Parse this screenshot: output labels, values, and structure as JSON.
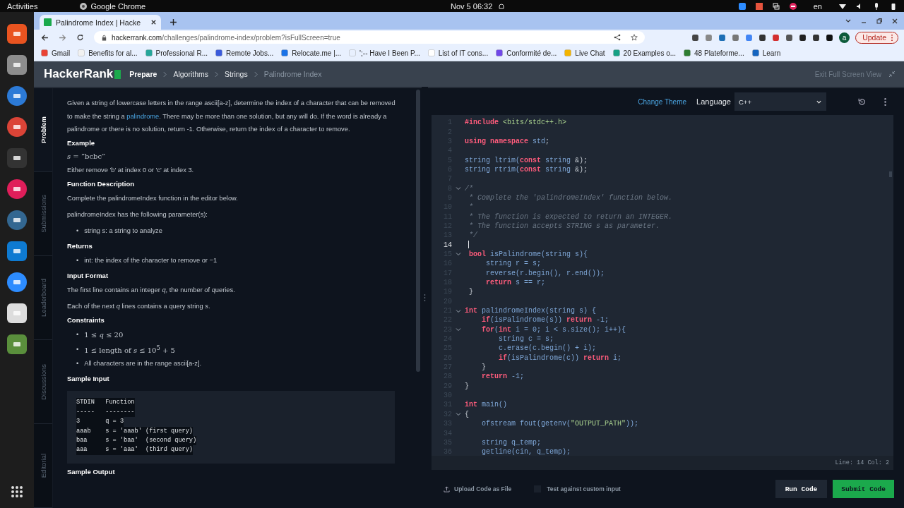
{
  "topbar": {
    "activities": "Activities",
    "app": "Google Chrome",
    "clock": "Nov 5  06:32",
    "lang": "en"
  },
  "browser": {
    "tab_title": "Palindrome Index | Hacke",
    "url_domain": "hackerrank.com",
    "url_path": "/challenges/palindrome-index/problem?isFullScreen=true",
    "profile": "a",
    "update": "Update",
    "bookmarks": [
      "Gmail",
      "Benefits for al...",
      "Professional R...",
      "Remote Jobs...",
      "Relocate.me |...",
      "';-- Have I Been P...",
      "List of IT cons...",
      "Conformité de...",
      "Live Chat",
      "20 Examples o...",
      "48 Plateforme...",
      "Learn"
    ]
  },
  "site": {
    "logo": "HackerRank",
    "breadcrumbs": [
      {
        "label": "Prepare",
        "current": false
      },
      {
        "label": "Algorithms",
        "current": false
      },
      {
        "label": "Strings",
        "current": false
      },
      {
        "label": "Palindrome Index",
        "current": true
      }
    ],
    "exit": "Exit Full Screen View"
  },
  "side_tabs": [
    {
      "label": "Problem",
      "selected": true
    },
    {
      "label": "Submissions",
      "selected": false
    },
    {
      "label": "Leaderboard",
      "selected": false
    },
    {
      "label": "Discussions",
      "selected": false
    },
    {
      "label": "Editorial",
      "selected": false
    }
  ],
  "problem": [
    {
      "kind": "intro",
      "before": "Given a string of lowercase letters in the range ascii[a-z], determine the index of a character that can be removed to make the string a ",
      "link": "palindrome",
      "after": ". There may be more than one solution, but any will do. If the word is already a palindrome or there is no solution, return -1. Otherwise, return the index of a character to remove."
    },
    {
      "kind": "heading",
      "text": "Example"
    },
    {
      "kind": "math",
      "text": "*s* = ”bcbc”"
    },
    {
      "kind": "para",
      "text": "Either remove 'b' at index 0 or 'c' at index 3."
    },
    {
      "kind": "heading",
      "text": "Function Description"
    },
    {
      "kind": "para",
      "text": "Complete the palindromeIndex function in the editor below."
    },
    {
      "kind": "para",
      "text": "palindromeIndex has the following parameter(s):"
    },
    {
      "kind": "bullets",
      "items": [
        {
          "marker": "•",
          "text": "string s: a string to analyze",
          "math": false
        }
      ]
    },
    {
      "kind": "heading",
      "text": "Returns"
    },
    {
      "kind": "bullets",
      "items": [
        {
          "marker": "•",
          "text": "int: the index of the character to remove or −1",
          "math": false
        }
      ]
    },
    {
      "kind": "heading",
      "text": "Input Format"
    },
    {
      "kind": "para",
      "text": "The first line contains an integer *q*, the number of queries."
    },
    {
      "kind": "para",
      "text": "Each of the next *q* lines contains a query string *s*."
    },
    {
      "kind": "heading",
      "text": "Constraints"
    },
    {
      "kind": "bullets",
      "items": [
        {
          "marker": "•",
          "text": "1 ≤ *q* ≤ 20",
          "math": true
        },
        {
          "marker": "•",
          "text": "1 ≤ length of *s* ≤ 10$^{5}$ + 5",
          "math": true
        },
        {
          "marker": "•",
          "text": "All characters are in the range ascii[a-z].",
          "math": false
        }
      ]
    },
    {
      "kind": "heading",
      "text": "Sample Input"
    },
    {
      "kind": "pre",
      "lines": [
        "STDIN   Function",
        "-----   --------",
        "3       q = 3",
        "aaab    s = 'aaab' (first query)",
        "baa     s = 'baa'  (second query)",
        "aaa     s = 'aaa'  (third query)"
      ]
    },
    {
      "kind": "heading",
      "text": "Sample Output"
    }
  ],
  "editor": {
    "change_theme": "Change Theme",
    "language_label": "Language",
    "language": "C++",
    "status": "Line: 14 Col: 2",
    "lines": [
      {
        "n": "1",
        "fold": false,
        "current": false,
        "tokens": [
          {
            "kind": "kw",
            "text": "#include "
          },
          {
            "kind": "str",
            "text": "<bits/stdc++.h>"
          }
        ]
      },
      {
        "n": "2",
        "fold": false,
        "current": false
      },
      {
        "n": "3",
        "fold": false,
        "current": false,
        "tokens": [
          {
            "kind": "kw",
            "text": "using namespace "
          },
          {
            "kind": "id",
            "text": "std"
          },
          {
            "kind": "pun",
            "text": ";"
          }
        ]
      },
      {
        "n": "4",
        "fold": false,
        "current": false
      },
      {
        "n": "5",
        "fold": false,
        "current": false,
        "tokens": [
          {
            "kind": "id",
            "text": "string ltrim("
          },
          {
            "kind": "kw",
            "text": "const"
          },
          {
            "kind": "id",
            "text": " string "
          },
          {
            "kind": "pun",
            "text": "&);"
          }
        ]
      },
      {
        "n": "6",
        "fold": false,
        "current": false,
        "tokens": [
          {
            "kind": "id",
            "text": "string rtrim("
          },
          {
            "kind": "kw",
            "text": "const"
          },
          {
            "kind": "id",
            "text": " string "
          },
          {
            "kind": "pun",
            "text": "&);"
          }
        ]
      },
      {
        "n": "7",
        "fold": false,
        "current": false
      },
      {
        "n": "8",
        "fold": true,
        "current": false,
        "tokens": [
          {
            "kind": "cm",
            "text": "/*"
          }
        ]
      },
      {
        "n": "9",
        "fold": false,
        "current": false,
        "tokens": [
          {
            "kind": "cm",
            "text": " * Complete the 'palindromeIndex' function below."
          }
        ]
      },
      {
        "n": "10",
        "fold": false,
        "current": false,
        "tokens": [
          {
            "kind": "cm",
            "text": " *"
          }
        ]
      },
      {
        "n": "11",
        "fold": false,
        "current": false,
        "tokens": [
          {
            "kind": "cm",
            "text": " * The function is expected to return an INTEGER."
          }
        ]
      },
      {
        "n": "12",
        "fold": false,
        "current": false,
        "tokens": [
          {
            "kind": "cm",
            "text": " * The function accepts STRING s as parameter."
          }
        ]
      },
      {
        "n": "13",
        "fold": false,
        "current": false,
        "tokens": [
          {
            "kind": "cm",
            "text": " */"
          }
        ]
      },
      {
        "n": "14",
        "fold": false,
        "current": true
      },
      {
        "n": "15",
        "fold": true,
        "current": false,
        "tokens": [
          {
            "kind": "kw",
            "text": " bool "
          },
          {
            "kind": "id",
            "text": "isPalindrome(string s){"
          }
        ]
      },
      {
        "n": "16",
        "fold": false,
        "current": false,
        "tokens": [
          {
            "kind": "id",
            "text": "     string r = s;"
          }
        ]
      },
      {
        "n": "17",
        "fold": false,
        "current": false,
        "tokens": [
          {
            "kind": "id",
            "text": "     reverse(r.begin(), r.end());"
          }
        ]
      },
      {
        "n": "18",
        "fold": false,
        "current": false,
        "tokens": [
          {
            "kind": "kw",
            "text": "     return "
          },
          {
            "kind": "id",
            "text": "s == r;"
          }
        ]
      },
      {
        "n": "19",
        "fold": false,
        "current": false,
        "tokens": [
          {
            "kind": "pun",
            "text": " }"
          }
        ]
      },
      {
        "n": "20",
        "fold": false,
        "current": false
      },
      {
        "n": "21",
        "fold": true,
        "current": false,
        "tokens": [
          {
            "kind": "kw",
            "text": "int "
          },
          {
            "kind": "id",
            "text": "palindromeIndex(string s) {"
          }
        ]
      },
      {
        "n": "22",
        "fold": false,
        "current": false,
        "tokens": [
          {
            "kind": "kw",
            "text": "    if"
          },
          {
            "kind": "id",
            "text": "(isPalindrome(s)) "
          },
          {
            "kind": "kw",
            "text": "return "
          },
          {
            "kind": "id",
            "text": "-1;"
          }
        ]
      },
      {
        "n": "23",
        "fold": true,
        "current": false,
        "tokens": [
          {
            "kind": "kw",
            "text": "    for"
          },
          {
            "kind": "id",
            "text": "("
          },
          {
            "kind": "kw",
            "text": "int"
          },
          {
            "kind": "id",
            "text": " i = 0; i < s.size(); i++){"
          }
        ]
      },
      {
        "n": "24",
        "fold": false,
        "current": false,
        "tokens": [
          {
            "kind": "id",
            "text": "        string c = s;"
          }
        ]
      },
      {
        "n": "25",
        "fold": false,
        "current": false,
        "tokens": [
          {
            "kind": "id",
            "text": "        c.erase(c.begin() + i);"
          }
        ]
      },
      {
        "n": "26",
        "fold": false,
        "current": false,
        "tokens": [
          {
            "kind": "kw",
            "text": "        if"
          },
          {
            "kind": "id",
            "text": "(isPalindrome(c)) "
          },
          {
            "kind": "kw",
            "text": "return "
          },
          {
            "kind": "id",
            "text": "i;"
          }
        ]
      },
      {
        "n": "27",
        "fold": false,
        "current": false,
        "tokens": [
          {
            "kind": "pun",
            "text": "    }"
          }
        ]
      },
      {
        "n": "28",
        "fold": false,
        "current": false,
        "tokens": [
          {
            "kind": "kw",
            "text": "    return "
          },
          {
            "kind": "id",
            "text": "-1;"
          }
        ]
      },
      {
        "n": "29",
        "fold": false,
        "current": false,
        "tokens": [
          {
            "kind": "pun",
            "text": "}"
          }
        ]
      },
      {
        "n": "30",
        "fold": false,
        "current": false
      },
      {
        "n": "31",
        "fold": false,
        "current": false,
        "tokens": [
          {
            "kind": "kw",
            "text": "int "
          },
          {
            "kind": "id",
            "text": "main()"
          }
        ]
      },
      {
        "n": "32",
        "fold": true,
        "current": false,
        "tokens": [
          {
            "kind": "pun",
            "text": "{"
          }
        ]
      },
      {
        "n": "33",
        "fold": false,
        "current": false,
        "tokens": [
          {
            "kind": "id",
            "text": "    ofstream fout(getenv("
          },
          {
            "kind": "str",
            "text": "\"OUTPUT_PATH\""
          },
          {
            "kind": "id",
            "text": "));"
          }
        ]
      },
      {
        "n": "34",
        "fold": false,
        "current": false
      },
      {
        "n": "35",
        "fold": false,
        "current": false,
        "tokens": [
          {
            "kind": "id",
            "text": "    string q_temp;"
          }
        ]
      },
      {
        "n": "36",
        "fold": false,
        "current": false,
        "tokens": [
          {
            "kind": "id",
            "text": "    getline(cin, q_temp);"
          }
        ]
      }
    ]
  },
  "footer": {
    "upload": "Upload Code as File",
    "custom_input": {
      "label": "Test against custom input",
      "checked": false
    },
    "run": "Run Code",
    "submit": "Submit Code"
  }
}
